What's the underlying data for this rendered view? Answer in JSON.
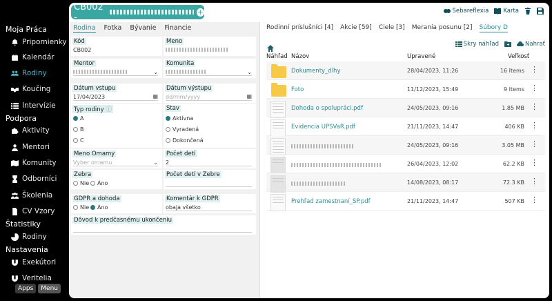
{
  "sidebar": {
    "groups": [
      {
        "label": "Moja Práca",
        "items": [
          {
            "label": "Pripomienky",
            "icon": "bell-icon"
          },
          {
            "label": "Kalendár",
            "icon": "calendar-icon"
          },
          {
            "label": "Rodiny",
            "icon": "people-icon",
            "active": true
          },
          {
            "label": "Koučing",
            "icon": "handshake-icon"
          },
          {
            "label": "Intervízie",
            "icon": "list-icon"
          }
        ]
      },
      {
        "label": "Podpora",
        "items": [
          {
            "label": "Aktivity",
            "icon": "puzzle-icon"
          },
          {
            "label": "Mentori",
            "icon": "person-icon"
          },
          {
            "label": "Komunity",
            "icon": "map-icon"
          },
          {
            "label": "Odborníci",
            "icon": "hourglass-icon"
          },
          {
            "label": "Školenia",
            "icon": "users-icon"
          },
          {
            "label": "CV Vzory",
            "icon": "file-icon"
          }
        ]
      },
      {
        "label": "Štatistiky",
        "items": [
          {
            "label": "Rodiny",
            "icon": "pie-icon"
          }
        ]
      },
      {
        "label": "Nastavenia",
        "items": [
          {
            "label": "Exekútori",
            "icon": "magnet-icon"
          },
          {
            "label": "Veritelia",
            "icon": "magnet-icon"
          }
        ]
      }
    ],
    "apps_label": "Apps",
    "menu_label": "Menu"
  },
  "header": {
    "title": "CB002 -",
    "actions": [
      {
        "label": "Sebareflexia",
        "icon": "brain-icon"
      },
      {
        "label": "Karta",
        "icon": "book-icon"
      }
    ]
  },
  "left": {
    "tabs": [
      "Rodina",
      "Fotka",
      "Bývanie",
      "Financie"
    ],
    "fields": {
      "kod": {
        "label": "Kód",
        "value": "CB002"
      },
      "meno": {
        "label": "Meno"
      },
      "mentor": {
        "label": "Mentor"
      },
      "komunita": {
        "label": "Komunita"
      },
      "datum_vstupu": {
        "label": "Dátum vstupu",
        "value": "17/04/2023"
      },
      "datum_vystupu": {
        "label": "Dátum výstupu",
        "placeholder": "dd/mm/yyyy"
      },
      "typ_rodiny": {
        "label": "Typ rodiny",
        "options": [
          "A",
          "B",
          "C"
        ],
        "selected": "A"
      },
      "stav": {
        "label": "Stav",
        "options": [
          "Aktívna",
          "Vyradená",
          "Dokončená"
        ],
        "selected": "Aktívna"
      },
      "meno_omamy": {
        "label": "Meno Omamy",
        "placeholder": "Vyber omamu"
      },
      "pocet_deti": {
        "label": "Počet detí",
        "value": "2"
      },
      "zebra": {
        "label": "Zebra",
        "options": [
          "Nie",
          "Áno"
        ],
        "selected": null
      },
      "pocet_deti_zebre": {
        "label": "Počet detí v Zebre"
      },
      "gdpr": {
        "label": "GDPR a dohoda",
        "options": [
          "Nie",
          "Áno"
        ],
        "selected": "Áno"
      },
      "komentar_gdpr": {
        "label": "Komentár k GDPR",
        "value": "obaja všetko"
      },
      "dovod": {
        "label": "Dôvod k predčasnému ukončeniu"
      }
    }
  },
  "right": {
    "tabs": [
      "Rodinní príslušníci [4]",
      "Akcie [59]",
      "Ciele [3]",
      "Merania posunu [2]",
      "Súbory D"
    ],
    "active_tab": "Súbory D",
    "actions": [
      "Skry náhľad",
      "Nahrať"
    ],
    "columns": [
      "Náhľad",
      "Názov",
      "Upravené",
      "Veľkosť"
    ],
    "files": [
      {
        "type": "folder",
        "name": "Dokumenty_dlhy",
        "modified": "28/04/2023, 11:26",
        "size": "16 Items"
      },
      {
        "type": "folder",
        "name": "Foto",
        "modified": "11/12/2023, 15:49",
        "size": "9 Items"
      },
      {
        "type": "doc",
        "name": "Dohoda o spolupráci.pdf",
        "modified": "24/05/2023, 09:16",
        "size": "1.85 MB"
      },
      {
        "type": "doc",
        "name": "Evidencia UPSVaR.pdf",
        "modified": "21/11/2023, 14:47",
        "size": "406 KB"
      },
      {
        "type": "doc",
        "name": "",
        "modified": "24/05/2023, 09:16",
        "size": "3.05 MB"
      },
      {
        "type": "doc",
        "name": "",
        "modified": "26/04/2023, 12:02",
        "size": "62.2 KB"
      },
      {
        "type": "doc",
        "name": "",
        "modified": "14/08/2023, 08:17",
        "size": "72.3 KB"
      },
      {
        "type": "doc",
        "name": "Prehľad zamestnaní_SP.pdf",
        "modified": "21/11/2023, 14:47",
        "size": "507 KB"
      }
    ]
  }
}
